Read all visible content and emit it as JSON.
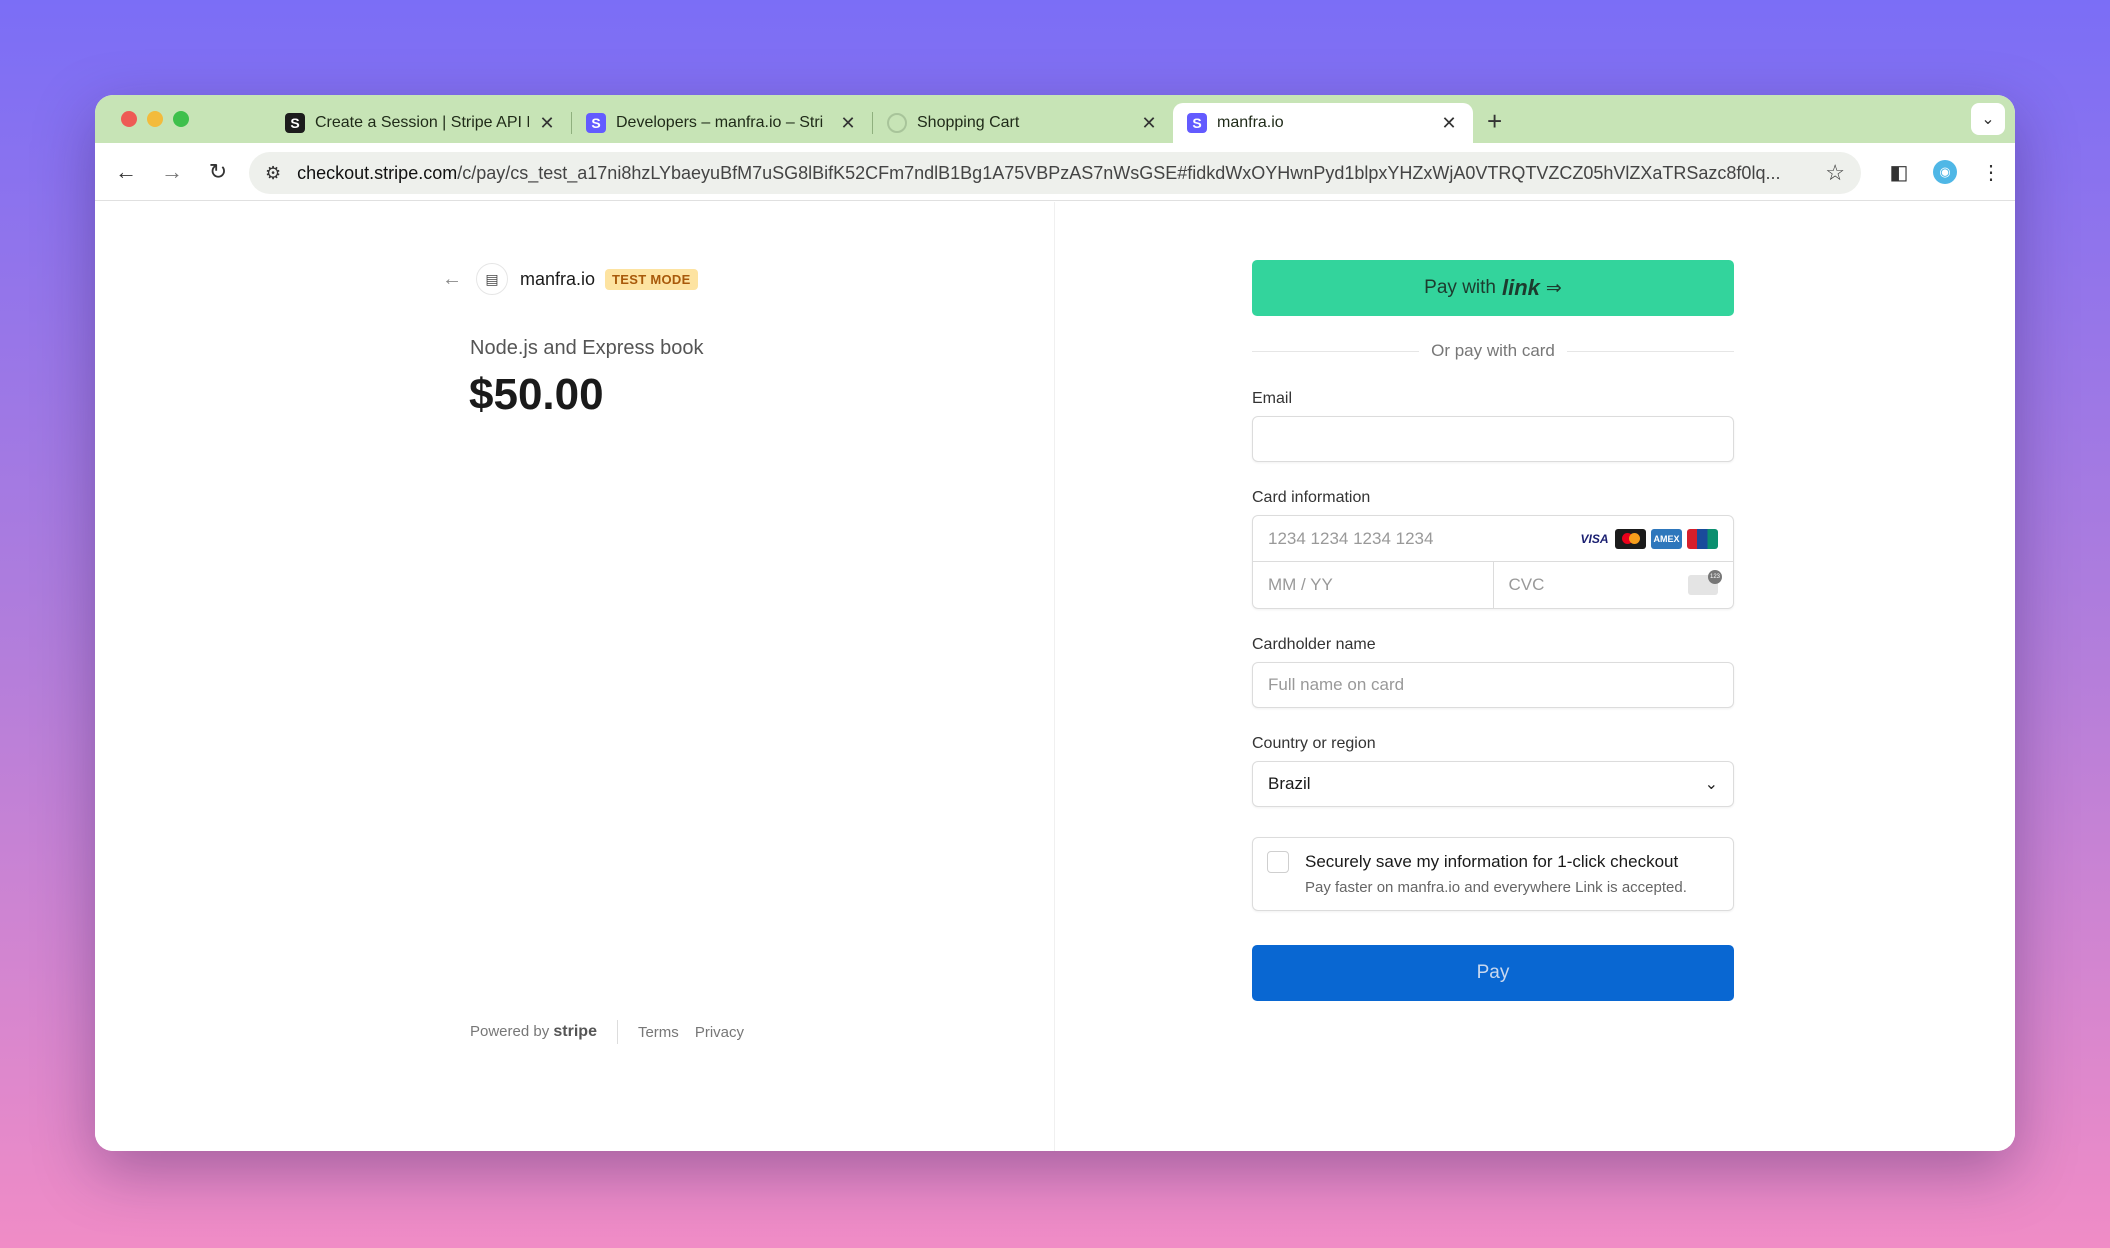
{
  "browser": {
    "tabs": [
      {
        "title": "Create a Session | Stripe API R",
        "favicon": "S"
      },
      {
        "title": "Developers – manfra.io – Stri",
        "favicon": "S"
      },
      {
        "title": "Shopping Cart",
        "favicon": ""
      },
      {
        "title": "manfra.io",
        "favicon": "S"
      }
    ],
    "new_tab": "+",
    "url_host": "checkout.stripe.com",
    "url_path": "/c/pay/cs_test_a17ni8hzLYbaeyuBfM7uSG8lBifK52CFm7ndlB1Bg1A75VBPzAS7nWsGSE#fidkdWxOYHwnPyd1blpxYHZxWjA0VTRQTVZCZ05hVlZXaTRSazc8f0lq..."
  },
  "checkout": {
    "merchant": "manfra.io",
    "badge": "TEST MODE",
    "product": "Node.js and Express book",
    "price": "$50.00",
    "footer": {
      "powered_by": "Powered by",
      "brand": "stripe",
      "terms": "Terms",
      "privacy": "Privacy"
    }
  },
  "form": {
    "link_button": {
      "prefix": "Pay with",
      "logo": "link",
      "arrow": "⇒"
    },
    "or_text": "Or pay with card",
    "email_label": "Email",
    "email_value": "",
    "card_label": "Card information",
    "card_number_placeholder": "1234 1234 1234 1234",
    "expiry_placeholder": "MM / YY",
    "cvc_placeholder": "CVC",
    "card_brands": [
      "VISA",
      "mastercard",
      "AMEX",
      "UnionPay"
    ],
    "cardholder_label": "Cardholder name",
    "cardholder_placeholder": "Full name on card",
    "country_label": "Country or region",
    "country_value": "Brazil",
    "save_title": "Securely save my information for 1-click checkout",
    "save_desc": "Pay faster on manfra.io and everywhere Link is accepted.",
    "pay_button": "Pay"
  },
  "colors": {
    "link_green": "#33d49c",
    "pay_blue": "#0967d2",
    "tabstrip": "#c7e4b6",
    "badge_bg": "#fde3a1"
  }
}
